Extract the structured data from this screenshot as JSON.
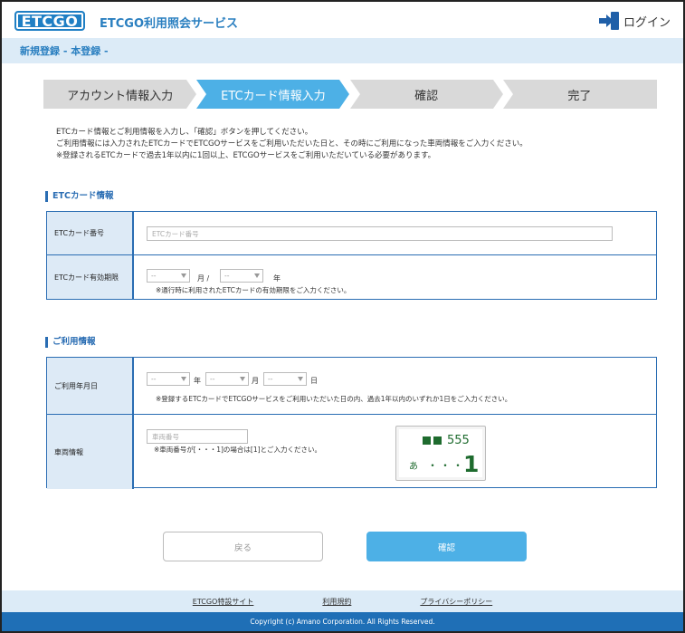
{
  "header": {
    "logo_text": "ETCGO",
    "site_title": "ETCGO利用照会サービス",
    "login_label": "ログイン"
  },
  "breadcrumb": "新規登録 - 本登録 -",
  "steps": [
    {
      "label": "アカウント情報入力",
      "state": "done"
    },
    {
      "label": "ETCカード情報入力",
      "state": "active"
    },
    {
      "label": "確認",
      "state": "todo"
    },
    {
      "label": "完了",
      "state": "todo"
    }
  ],
  "colors": {
    "step_active": "#4db0e6",
    "step_inactive": "#d9d9d9",
    "accent": "#2a6db3"
  },
  "intro": [
    "ETCカード情報とご利用情報を入力し、「確認」ボタンを押してください。",
    "ご利用情報には入力されたETCカードでETCGOサービスをご利用いただいた日と、その時にご利用になった車両情報をご入力ください。",
    "※登録されるETCカードで過去1年以内に1回以上、ETCGOサービスをご利用いただいている必要があります。"
  ],
  "card_section": {
    "title": "ETCカード情報",
    "number_label": "ETCカード番号",
    "number_placeholder": "ETCカード番号",
    "expiry_label": "ETCカード有効期限",
    "month_value": "--",
    "year_value": "--",
    "month_unit": "月 /",
    "year_unit": "年",
    "expiry_note": "※通行時に利用されたETCカードの有効期限をご入力ください。"
  },
  "usage_section": {
    "title": "ご利用情報",
    "date_label": "ご利用年月日",
    "year_value": "--",
    "month_value": "--",
    "day_value": "--",
    "year_unit": "年",
    "month_unit": "月",
    "day_unit": "日",
    "date_note": "※登録するETCカードでETCGOサービスをご利用いただいた日の内、過去1年以内のいずれか1日をご入力ください。",
    "vehicle_label": "車両情報",
    "vehicle_placeholder": "車両番号",
    "vehicle_note": "※車両番号が[・・・1]の場合は[1]とご入力ください。",
    "plate_top": "555",
    "plate_kana": "あ",
    "plate_dots": "・・・",
    "plate_num": "1"
  },
  "buttons": {
    "back": "戻る",
    "confirm": "確認"
  },
  "footer": {
    "links": [
      "ETCGO特設サイト",
      "利用規約",
      "プライバシーポリシー"
    ],
    "copyright": "Copyright (c) Amano Corporation. All Rights Reserved."
  }
}
